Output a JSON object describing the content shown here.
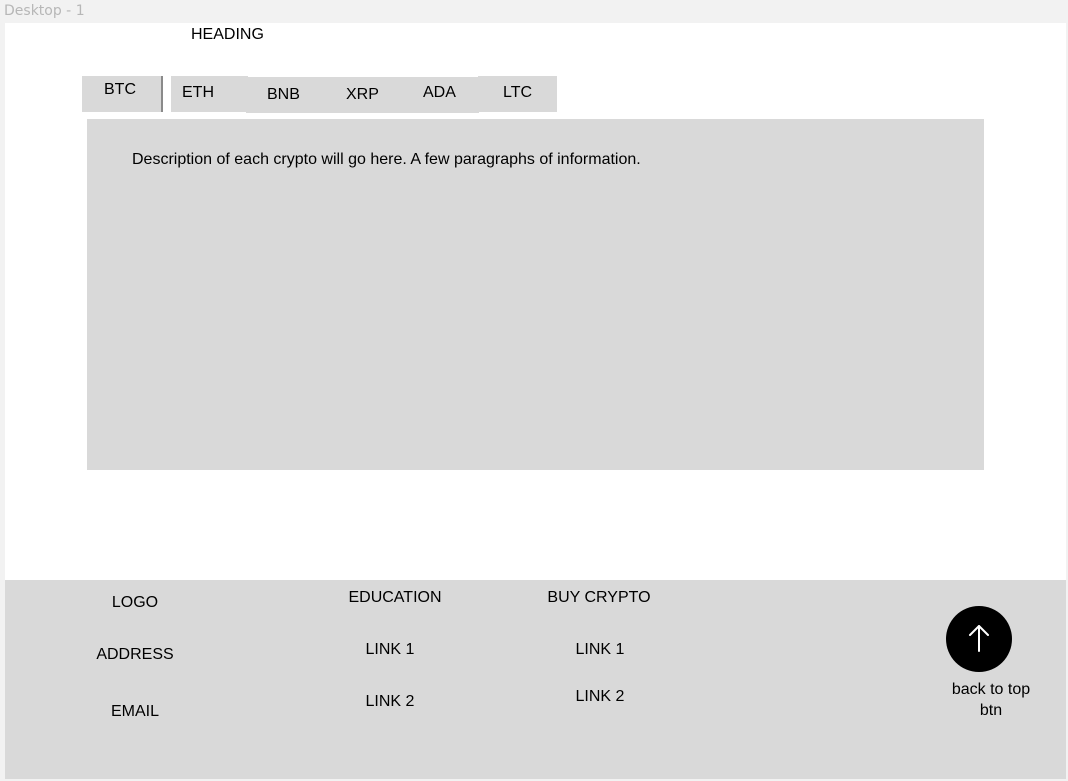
{
  "frame": {
    "label": "Desktop - 1"
  },
  "header": {
    "heading": "HEADING"
  },
  "tabs": [
    {
      "label": "BTC",
      "selected": true
    },
    {
      "label": "ETH"
    },
    {
      "label": "BNB"
    },
    {
      "label": "XRP"
    },
    {
      "label": "ADA"
    },
    {
      "label": "LTC"
    }
  ],
  "content": {
    "description": "Description of each crypto will go here. A few paragraphs of information."
  },
  "footer": {
    "col1": {
      "logo": "LOGO",
      "address": "ADDRESS",
      "email": "EMAIL"
    },
    "education": {
      "title": "EDUCATION",
      "link1": "LINK 1",
      "link2": "LINK 2"
    },
    "buy_crypto": {
      "title": "BUY CRYPTO",
      "link1": "LINK 1",
      "link2": "LINK 2"
    },
    "back_to_top": {
      "icon": "arrow-up-icon",
      "caption": "back to top btn"
    }
  },
  "colors": {
    "panel": "#d9d9d9",
    "button": "#000000",
    "canvas": "#f2f2f2"
  }
}
